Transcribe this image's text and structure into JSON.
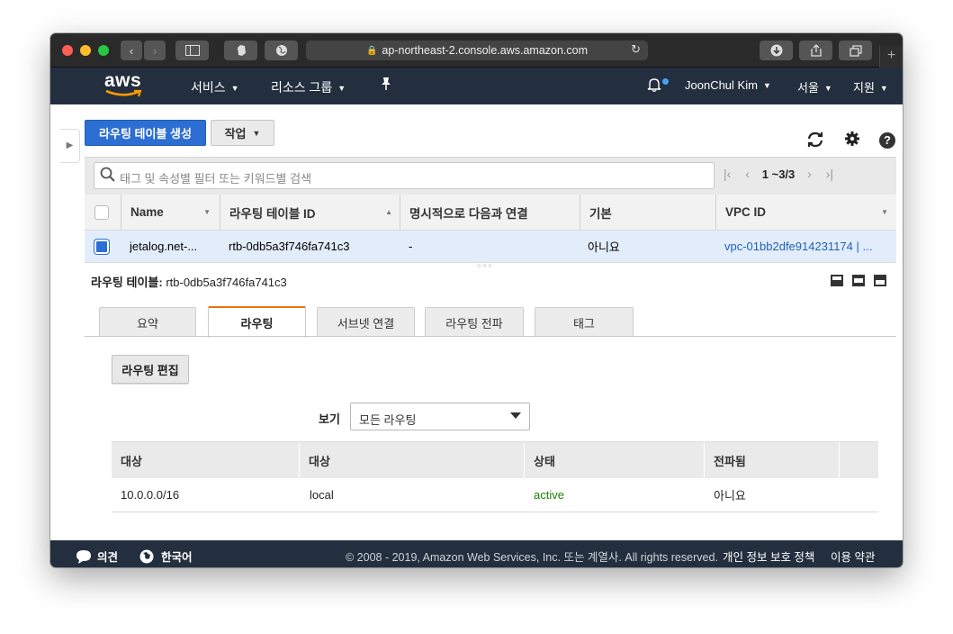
{
  "browser": {
    "url": "ap-northeast-2.console.aws.amazon.com"
  },
  "aws_nav": {
    "logo": "aws",
    "services": "서비스",
    "resource_groups": "리소스 그룹",
    "user": "JoonChul Kim",
    "region": "서울",
    "support": "지원"
  },
  "toolbar": {
    "create_label": "라우팅 테이블 생성",
    "actions_label": "작업"
  },
  "filter": {
    "placeholder": "태그 및 속성별 필터 또는 키워드별 검색",
    "range": "1 ~3/3"
  },
  "main_table": {
    "headers": [
      "Name",
      "라우팅 테이블 ID",
      "명시적으로 다음과 연결",
      "기본",
      "VPC ID"
    ],
    "rows": [
      {
        "name": "jetalog.net-...",
        "id": "rtb-0db5a3f746fa741c3",
        "explicit": "-",
        "main": "아니요",
        "vpc": "vpc-01bb2dfe914231174 | ..."
      }
    ]
  },
  "detail": {
    "title_label": "라우팅 테이블:",
    "title_value": "rtb-0db5a3f746fa741c3",
    "tabs": [
      "요약",
      "라우팅",
      "서브넷 연결",
      "라우팅 전파",
      "태그"
    ],
    "active_tab": "라우팅",
    "edit_button": "라우팅 편집",
    "view_label": "보기",
    "view_value": "모든 라우팅",
    "route_headers": [
      "대상",
      "대상",
      "상태",
      "전파됨"
    ],
    "routes": [
      {
        "destination": "10.0.0.0/16",
        "target": "local",
        "status": "active",
        "propagated": "아니요"
      }
    ]
  },
  "footer": {
    "feedback": "의견",
    "language": "한국어",
    "copyright": "© 2008 - 2019, Amazon Web Services, Inc. 또는 계열사. All rights reserved.",
    "privacy": "개인 정보 보호 정책",
    "terms": "이용 약관"
  },
  "colors": {
    "nav_bg": "#232f3e",
    "primary": "#2d6ed2",
    "tab_accent": "#ec7211",
    "active_status": "#1d8102",
    "link": "#1c63b8"
  },
  "icons": [
    "lock-icon",
    "reload-icon",
    "bell-icon",
    "pin-icon",
    "refresh-icon",
    "gear-icon",
    "help-icon",
    "search-icon",
    "feedback-icon",
    "globe-icon"
  ]
}
